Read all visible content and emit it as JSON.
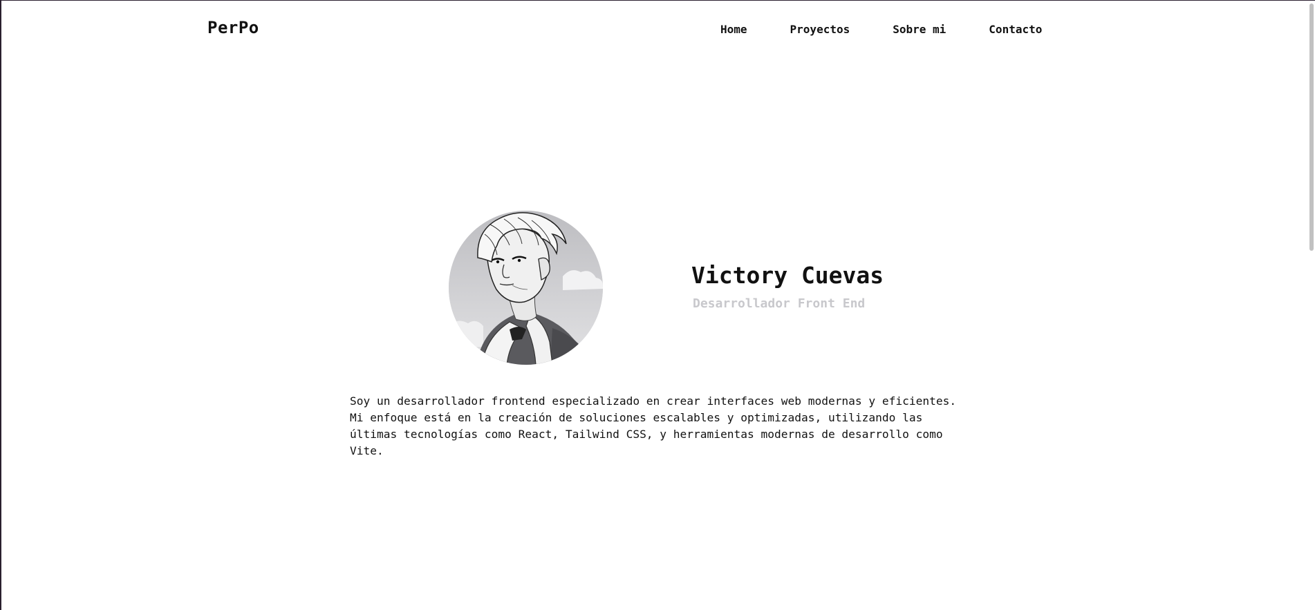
{
  "navbar": {
    "logo": "PerPo",
    "links": [
      {
        "label": "Home"
      },
      {
        "label": "Proyectos"
      },
      {
        "label": "Sobre mi"
      },
      {
        "label": "Contacto"
      }
    ]
  },
  "hero": {
    "name": "Victory Cuevas",
    "role": "Desarrollador Front End",
    "bio_lines": [
      "Soy un desarrollador frontend especializado en crear interfaces web modernas y eficientes.",
      "Mi enfoque está en la creación de soluciones escalables y optimizadas, utilizando las",
      "últimas tecnologías como React, Tailwind CSS, y herramientas modernas de desarrollo como",
      "Vite."
    ]
  },
  "colors": {
    "background": "#ffffff",
    "text": "#111111",
    "muted": "#c8c8cc"
  }
}
